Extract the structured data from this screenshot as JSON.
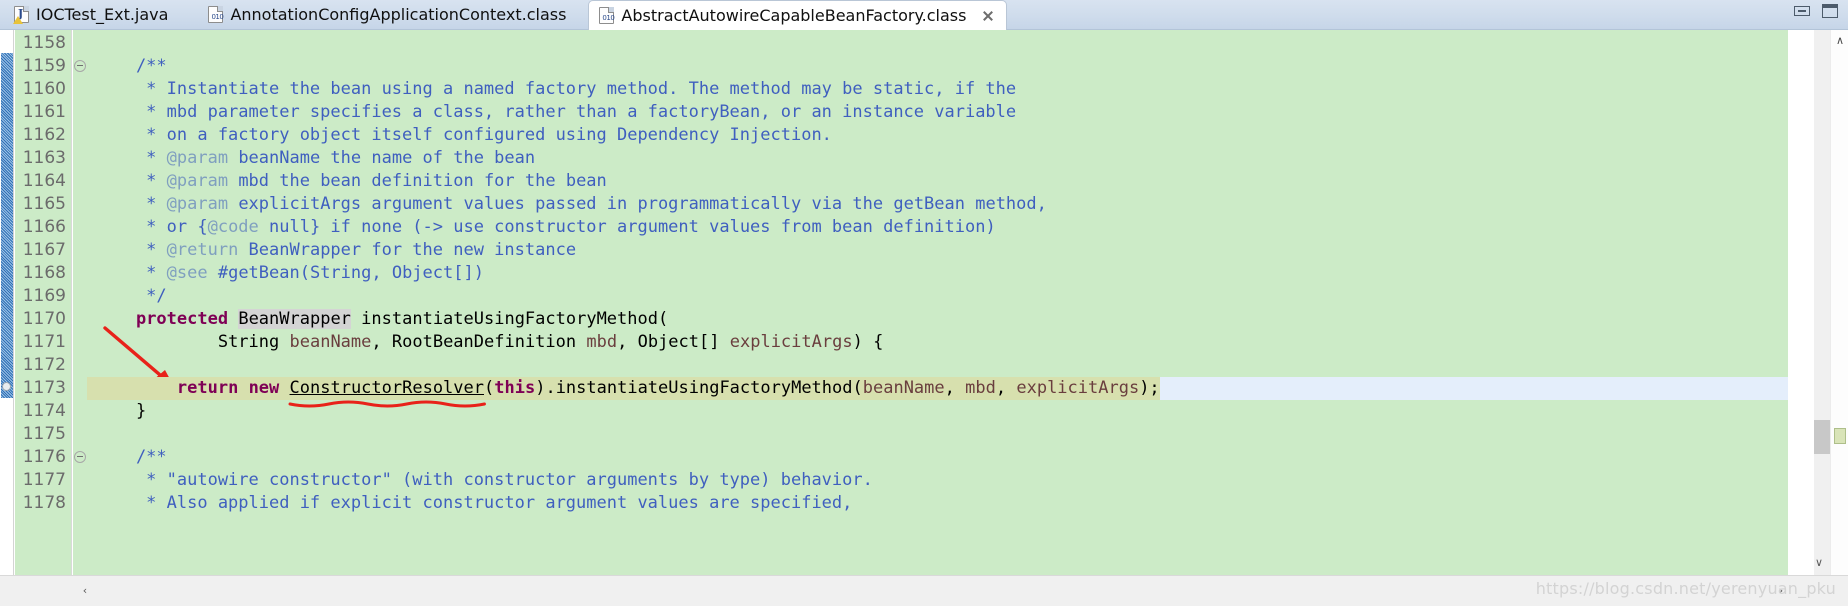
{
  "window": {
    "minimize_label": "Minimize",
    "maximize_label": "Maximize"
  },
  "tabs": [
    {
      "label": "IOCTest_Ext.java",
      "icon": "java-file-icon",
      "active": false,
      "closable": false,
      "badge": "J"
    },
    {
      "label": "AnnotationConfigApplicationContext.class",
      "icon": "class-file-icon",
      "active": false,
      "closable": false,
      "badge": "010"
    },
    {
      "label": "AbstractAutowireCapableBeanFactory.class",
      "icon": "class-file-icon",
      "active": true,
      "closable": true,
      "badge": "010"
    }
  ],
  "editor": {
    "first_line": 1158,
    "current_line": 1173,
    "fold_lines": [
      1159,
      1176
    ],
    "breakpoint_line": 1173,
    "lines": [
      {
        "n": 1158,
        "text": ""
      },
      {
        "n": 1159,
        "text": "    /**"
      },
      {
        "n": 1160,
        "text": "     * Instantiate the bean using a named factory method. The method may be static, if the"
      },
      {
        "n": 1161,
        "text": "     * mbd parameter specifies a class, rather than a factoryBean, or an instance variable"
      },
      {
        "n": 1162,
        "text": "     * on a factory object itself configured using Dependency Injection."
      },
      {
        "n": 1163,
        "text": "     * @param beanName the name of the bean"
      },
      {
        "n": 1164,
        "text": "     * @param mbd the bean definition for the bean"
      },
      {
        "n": 1165,
        "text": "     * @param explicitArgs argument values passed in programmatically via the getBean method,"
      },
      {
        "n": 1166,
        "text": "     * or {@code null} if none (-> use constructor argument values from bean definition)"
      },
      {
        "n": 1167,
        "text": "     * @return BeanWrapper for the new instance"
      },
      {
        "n": 1168,
        "text": "     * @see #getBean(String, Object[])"
      },
      {
        "n": 1169,
        "text": "     */"
      },
      {
        "n": 1170,
        "text": "    protected BeanWrapper instantiateUsingFactoryMethod("
      },
      {
        "n": 1171,
        "text": "            String beanName, RootBeanDefinition mbd, Object[] explicitArgs) {"
      },
      {
        "n": 1172,
        "text": ""
      },
      {
        "n": 1173,
        "text": "        return new ConstructorResolver(this).instantiateUsingFactoryMethod(beanName, mbd, explicitArgs);"
      },
      {
        "n": 1174,
        "text": "    }"
      },
      {
        "n": 1175,
        "text": ""
      },
      {
        "n": 1176,
        "text": "    /**"
      },
      {
        "n": 1177,
        "text": "     * \"autowire constructor\" (with constructor arguments by type) behavior."
      },
      {
        "n": 1178,
        "text": "     * Also applied if explicit constructor argument values are specified,"
      }
    ],
    "highlighted_token": "BeanWrapper",
    "annotated_token": "ConstructorResolver"
  },
  "scrollbars": {
    "up_arrow": "∧",
    "down_arrow": "∨",
    "left_arrow": "‹",
    "right_arrow": "›"
  },
  "watermark": {
    "text": "https://blog.csdn.net/yerenyuan_pku"
  },
  "colors": {
    "editor_background": "#ccebc7",
    "current_line": "#e4eefb",
    "selection": "#d7e0ae",
    "javadoc": "#3f5fbf",
    "javadoc_tag": "#7f9fbf",
    "keyword": "#7f0055",
    "parameter": "#6a3e3e",
    "annotation_red": "#e8221a",
    "occurrence_highlight": "#d4d4d4"
  }
}
